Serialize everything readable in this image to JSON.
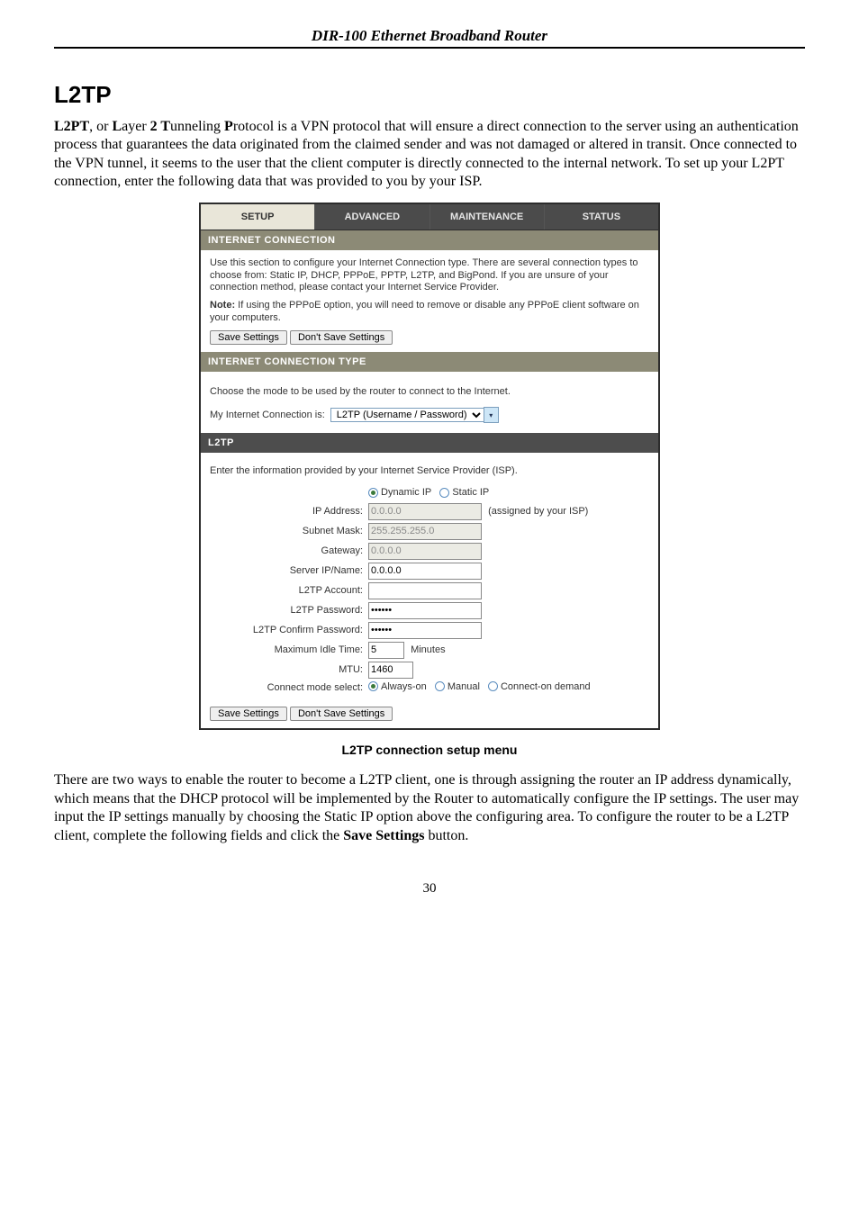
{
  "header": {
    "title": "DIR-100 Ethernet Broadband Router"
  },
  "section": {
    "heading": "L2TP",
    "intro_html": "L2PT, or Layer 2 Tunneling Protocol is a VPN protocol that will ensure a direct connection to the server using an authentication process that guarantees the data originated from the claimed sender and was not damaged or altered in transit. Once connected to the VPN tunnel, it seems to the user that the client computer is directly connected to the internal network. To set up your L2PT connection, enter the following data that was provided to you by your ISP."
  },
  "app": {
    "tabs": {
      "setup": "SETUP",
      "advanced": "ADVANCED",
      "maintenance": "MAINTENANCE",
      "status": "STATUS"
    },
    "conn_section": {
      "title": "INTERNET CONNECTION",
      "desc": "Use this section to configure your Internet Connection type. There are several connection types to choose from: Static IP, DHCP, PPPoE, PPTP, L2TP, and BigPond. If you are unsure of your connection method, please contact your Internet Service Provider.",
      "note_label": "Note:",
      "note_text": " If using the PPPoE option, you will need to remove or disable any PPPoE client software on your computers.",
      "save": "Save Settings",
      "dont_save": "Don't Save Settings"
    },
    "type_section": {
      "title": "INTERNET CONNECTION TYPE",
      "desc": "Choose the mode to be used by the router to connect to the Internet.",
      "label": "My Internet Connection is:",
      "value": "L2TP (Username / Password)"
    },
    "l2tp_section": {
      "title": "L2TP",
      "desc": "Enter the information provided by your Internet Service Provider (ISP).",
      "ipmode": {
        "dynamic": "Dynamic IP",
        "static": "Static IP"
      },
      "fields": {
        "ip_label": "IP Address:",
        "ip_value": "0.0.0.0",
        "ip_hint": "(assigned by your ISP)",
        "mask_label": "Subnet Mask:",
        "mask_value": "255.255.255.0",
        "gw_label": "Gateway:",
        "gw_value": "0.0.0.0",
        "srv_label": "Server IP/Name:",
        "srv_value": "0.0.0.0",
        "acct_label": "L2TP Account:",
        "acct_value": "",
        "pw_label": "L2TP Password:",
        "pw_value": "••••••",
        "cpw_label": "L2TP Confirm Password:",
        "cpw_value": "••••••",
        "idle_label": "Maximum Idle Time:",
        "idle_value": "5",
        "idle_unit": "Minutes",
        "mtu_label": "MTU:",
        "mtu_value": "1460",
        "mode_label": "Connect mode select:",
        "mode_always": "Always-on",
        "mode_manual": "Manual",
        "mode_demand": "Connect-on demand"
      },
      "save": "Save Settings",
      "dont_save": "Don't Save Settings"
    }
  },
  "caption": "L2TP connection setup menu",
  "outro": {
    "text_pre": "There are two ways to enable the router to become a L2TP client, one is through assigning the router an IP address dynamically, which means that the DHCP protocol will be implemented by the Router to automatically configure the IP settings. The user may input the IP settings manually by choosing the Static IP option above the configuring area. To configure the router to be a L2TP client, complete the following fields and click the ",
    "bold": "Save Settings",
    "text_post": " button."
  },
  "page_number": "30"
}
